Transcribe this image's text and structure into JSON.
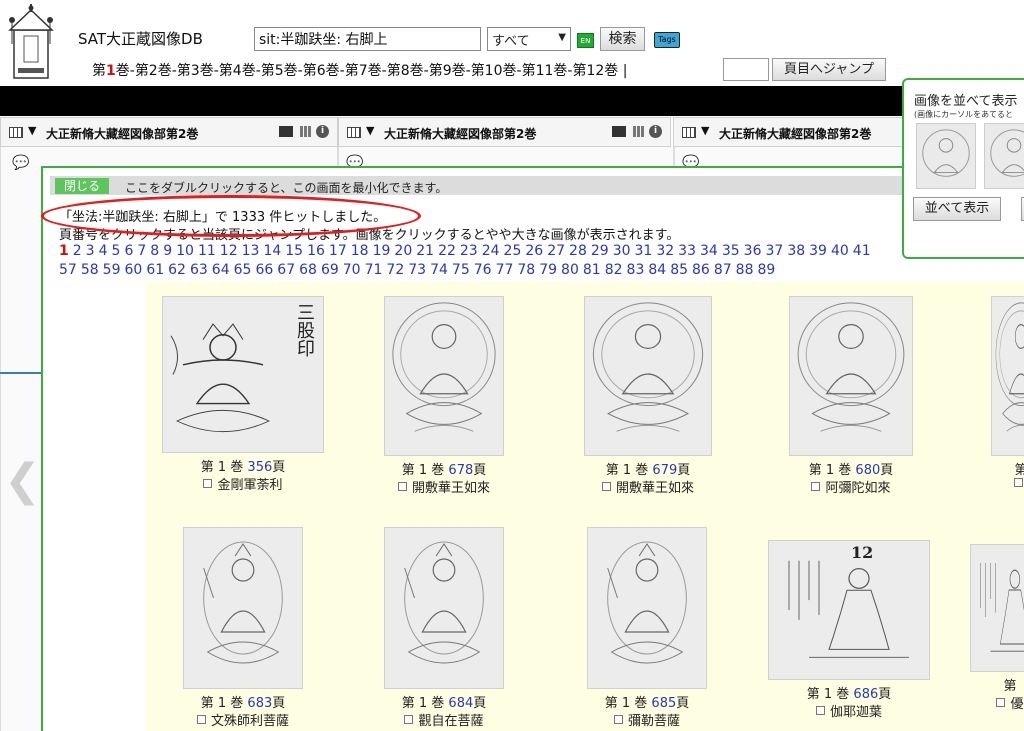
{
  "app": {
    "title": "SAT大正蔵図像DB"
  },
  "search": {
    "value": "sit:半跏趺坐: 右脚上",
    "scope": "すべて",
    "en_label": "EN",
    "button": "検索",
    "tags_label": "Tags"
  },
  "volumes": [
    "第1巻",
    "第2巻",
    "第3巻",
    "第4巻",
    "第5巻",
    "第6巻",
    "第7巻",
    "第8巻",
    "第9巻",
    "第10巻",
    "第11巻",
    "第12巻"
  ],
  "volume_separator": "-",
  "volume_suffix": " |",
  "jump": {
    "button": "頁目へジャンプ"
  },
  "panels": [
    {
      "title": "大正新脩大藏經図像部第2巻"
    },
    {
      "title": "大正新脩大藏經図像部第2巻"
    },
    {
      "title": "大正新脩大藏經図像部第2巻"
    }
  ],
  "results": {
    "close": "閉じる",
    "dblclick_hint": "ここをダブルクリックすると、この画面を最小化できます。",
    "hit_text": "「坐法:半跏趺坐: 右脚上」で 1333 件ヒットしました。",
    "click_hint": "頁番号をクリックすると当該頁にジャンプします。画像をクリックするとやや大きな画像が表示されます。",
    "current_page": "1",
    "pages_row1": [
      "2",
      "3",
      "4",
      "5",
      "6",
      "7",
      "8",
      "9",
      "10",
      "11",
      "12",
      "13",
      "14",
      "15",
      "16",
      "17",
      "18",
      "19",
      "20",
      "21",
      "22",
      "23",
      "24",
      "25",
      "26",
      "27",
      "28",
      "29",
      "30",
      "31",
      "32",
      "33",
      "34",
      "35",
      "36",
      "37",
      "38",
      "39",
      "40",
      "41"
    ],
    "pages_row2": [
      "57",
      "58",
      "59",
      "60",
      "61",
      "62",
      "63",
      "64",
      "65",
      "66",
      "67",
      "68",
      "69",
      "70",
      "71",
      "72",
      "73",
      "74",
      "75",
      "76",
      "77",
      "78",
      "79",
      "80",
      "81",
      "82",
      "83",
      "84",
      "85",
      "86",
      "87",
      "88",
      "89"
    ]
  },
  "items": [
    {
      "vol": "第 1 巻",
      "page": "356",
      "unit": "頁",
      "name": "金剛軍荼利"
    },
    {
      "vol": "第 1 巻",
      "page": "678",
      "unit": "頁",
      "name": "開敷華王如來"
    },
    {
      "vol": "第 1 巻",
      "page": "679",
      "unit": "頁",
      "name": "開敷華王如來"
    },
    {
      "vol": "第 1 巻",
      "page": "680",
      "unit": "頁",
      "name": "阿彌陀如來"
    },
    {
      "vol": "第",
      "page": "",
      "unit": "",
      "name": ""
    },
    {
      "vol": "第 1 巻",
      "page": "683",
      "unit": "頁",
      "name": "文殊師利菩薩"
    },
    {
      "vol": "第 1 巻",
      "page": "684",
      "unit": "頁",
      "name": "觀自在菩薩"
    },
    {
      "vol": "第 1 巻",
      "page": "685",
      "unit": "頁",
      "name": "彌勒菩薩"
    },
    {
      "vol": "第 1 巻",
      "page": "686",
      "unit": "頁",
      "name": "伽耶迦葉"
    },
    {
      "vol": "第",
      "page": "",
      "unit": "",
      "name": "優"
    }
  ],
  "thumb_text": {
    "sanko_in": "三股印",
    "page_no": "12"
  },
  "side_popup": {
    "title": "画像を並べて表示",
    "note": "(画像にカーソルをあてると",
    "button": "並べて表示"
  }
}
